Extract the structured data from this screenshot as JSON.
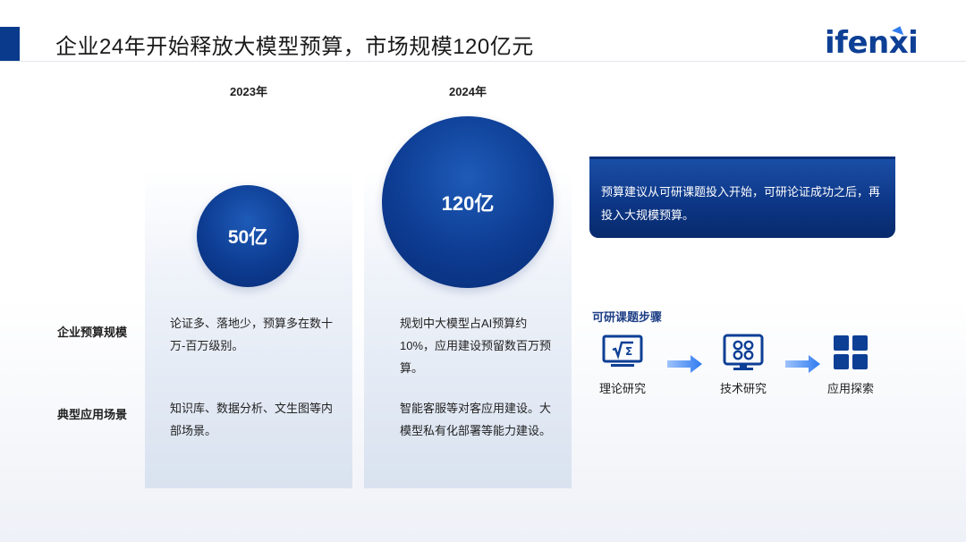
{
  "header": {
    "title": "企业24年开始释放大模型预算，市场规模120亿元",
    "logo_text": "ifenxi"
  },
  "colors": {
    "brand": "#0d3f95",
    "accent": "#2f7bf0",
    "bubble": "#0d3c92"
  },
  "row_labels": {
    "budget": "企业预算规模",
    "scenario": "典型应用场景"
  },
  "columns": [
    {
      "year": "2023年",
      "market_size": "50亿",
      "budget_text": "论证多、落地少，预算多在数十万-百万级别。",
      "scenario_text": "知识库、数据分析、文生图等内部场景。"
    },
    {
      "year": "2024年",
      "market_size": "120亿",
      "budget_text": "规划中大模型占AI预算约10%，应用建设预留数百万预算。",
      "scenario_text": "智能客服等对客应用建设。大模型私有化部署等能力建设。"
    }
  ],
  "callout": {
    "text": "预算建议从可研课题投入开始，可研论证成功之后，再投入大规模预算。"
  },
  "steps": {
    "title": "可研课题步骤",
    "items": [
      {
        "label": "理论研究",
        "icon": "sqrt-formula-monitor-icon"
      },
      {
        "label": "技术研究",
        "icon": "grid-monitor-icon"
      },
      {
        "label": "应用探索",
        "icon": "four-squares-icon"
      }
    ]
  }
}
